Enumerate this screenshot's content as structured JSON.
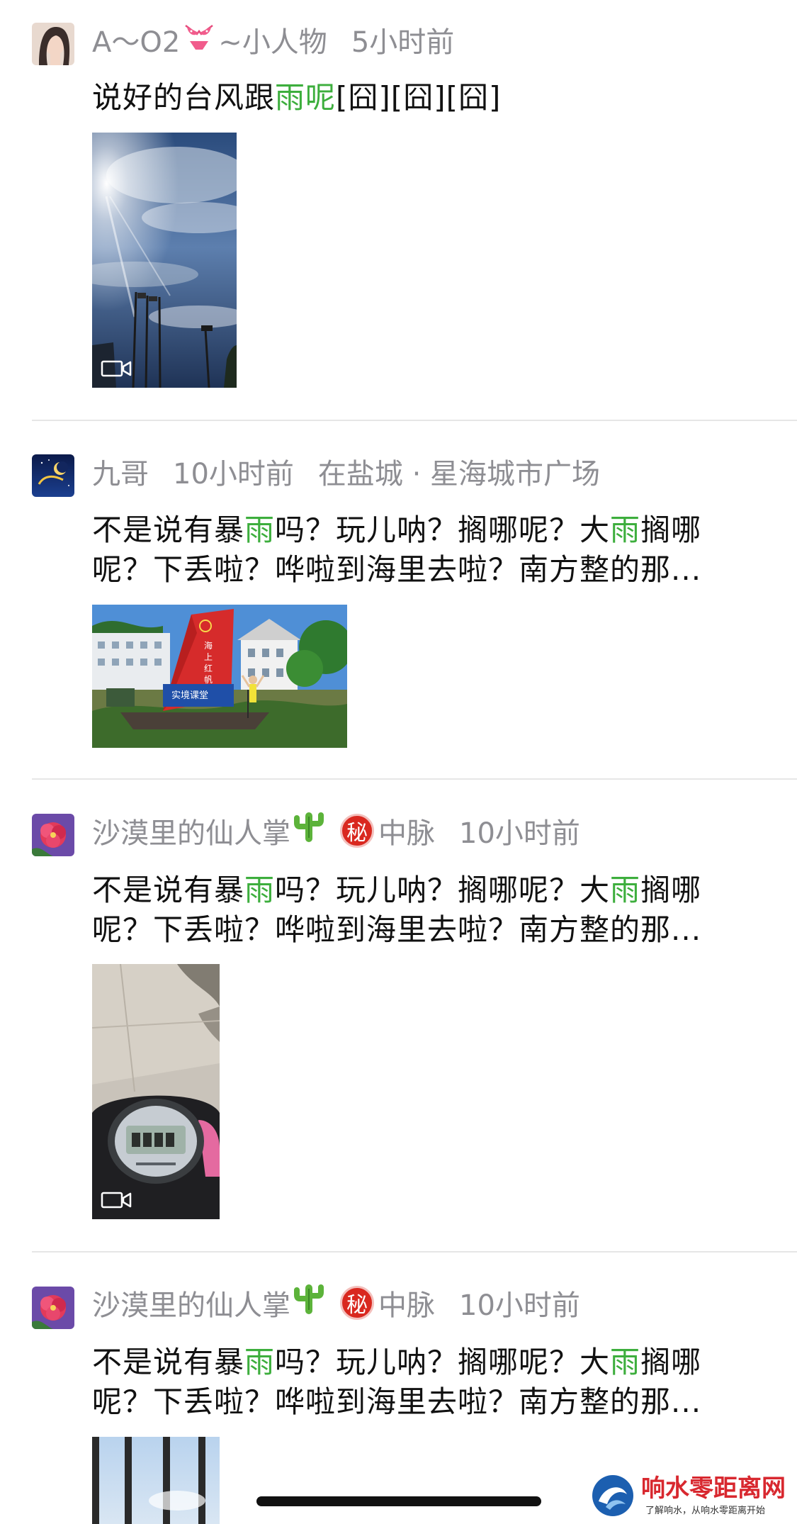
{
  "posts": [
    {
      "author": "A～O2",
      "author_suffix": "~小人物",
      "author_emoji": "bikini-emoji",
      "time": "5小时前",
      "text_lines": [
        [
          {
            "t": "说好的台风跟"
          },
          {
            "t": "雨呢",
            "hl": true
          },
          {
            "t": "[囧][囧][囧]"
          }
        ]
      ],
      "media": "video",
      "divider": true
    },
    {
      "author": "九哥",
      "time": "10小时前",
      "location": "在盐城 · 星海城市广场",
      "text_lines": [
        [
          {
            "t": "不是说有暴"
          },
          {
            "t": "雨",
            "hl": true
          },
          {
            "t": "吗？玩儿呐？搁哪呢？大"
          },
          {
            "t": "雨",
            "hl": true
          },
          {
            "t": "搁哪"
          }
        ],
        [
          {
            "t": "呢？下丢啦？哗啦到海里去啦？南方整的那..."
          }
        ]
      ],
      "media": "image",
      "image_signs": {
        "sail_line1": "海",
        "sail_line2": "上",
        "sail_line3": "红",
        "sail_line4": "帆",
        "banner": "实境课堂"
      },
      "divider": true
    },
    {
      "author": "沙漠里的仙人掌",
      "author_emoji": "cactus-emoji",
      "badge": "秘",
      "group": "中脉",
      "time": "10小时前",
      "text_lines": [
        [
          {
            "t": "不是说有暴"
          },
          {
            "t": "雨",
            "hl": true
          },
          {
            "t": "吗？玩儿呐？搁哪呢？大"
          },
          {
            "t": "雨",
            "hl": true
          },
          {
            "t": "搁哪"
          }
        ],
        [
          {
            "t": "呢？下丢啦？哗啦到海里去啦？南方整的那..."
          }
        ]
      ],
      "media": "video",
      "divider": true
    },
    {
      "author": "沙漠里的仙人掌",
      "author_emoji": "cactus-emoji",
      "badge": "秘",
      "group": "中脉",
      "time": "10小时前",
      "text_lines": [
        [
          {
            "t": "不是说有暴"
          },
          {
            "t": "雨",
            "hl": true
          },
          {
            "t": "吗？玩儿呐？搁哪呢？大"
          },
          {
            "t": "雨",
            "hl": true
          },
          {
            "t": "搁哪"
          }
        ],
        [
          {
            "t": "呢？下丢啦？哗啦到海里去啦？南方整的那..."
          }
        ]
      ],
      "media": "image",
      "divider": false
    }
  ],
  "watermark": {
    "title": "响水零距离网",
    "subtitle": "了解响水，从响水零距离开始"
  },
  "colors": {
    "highlight": "#3dae3d",
    "meta_text": "#8e8e93",
    "body_text": "#111111",
    "badge": "#d9281f"
  }
}
